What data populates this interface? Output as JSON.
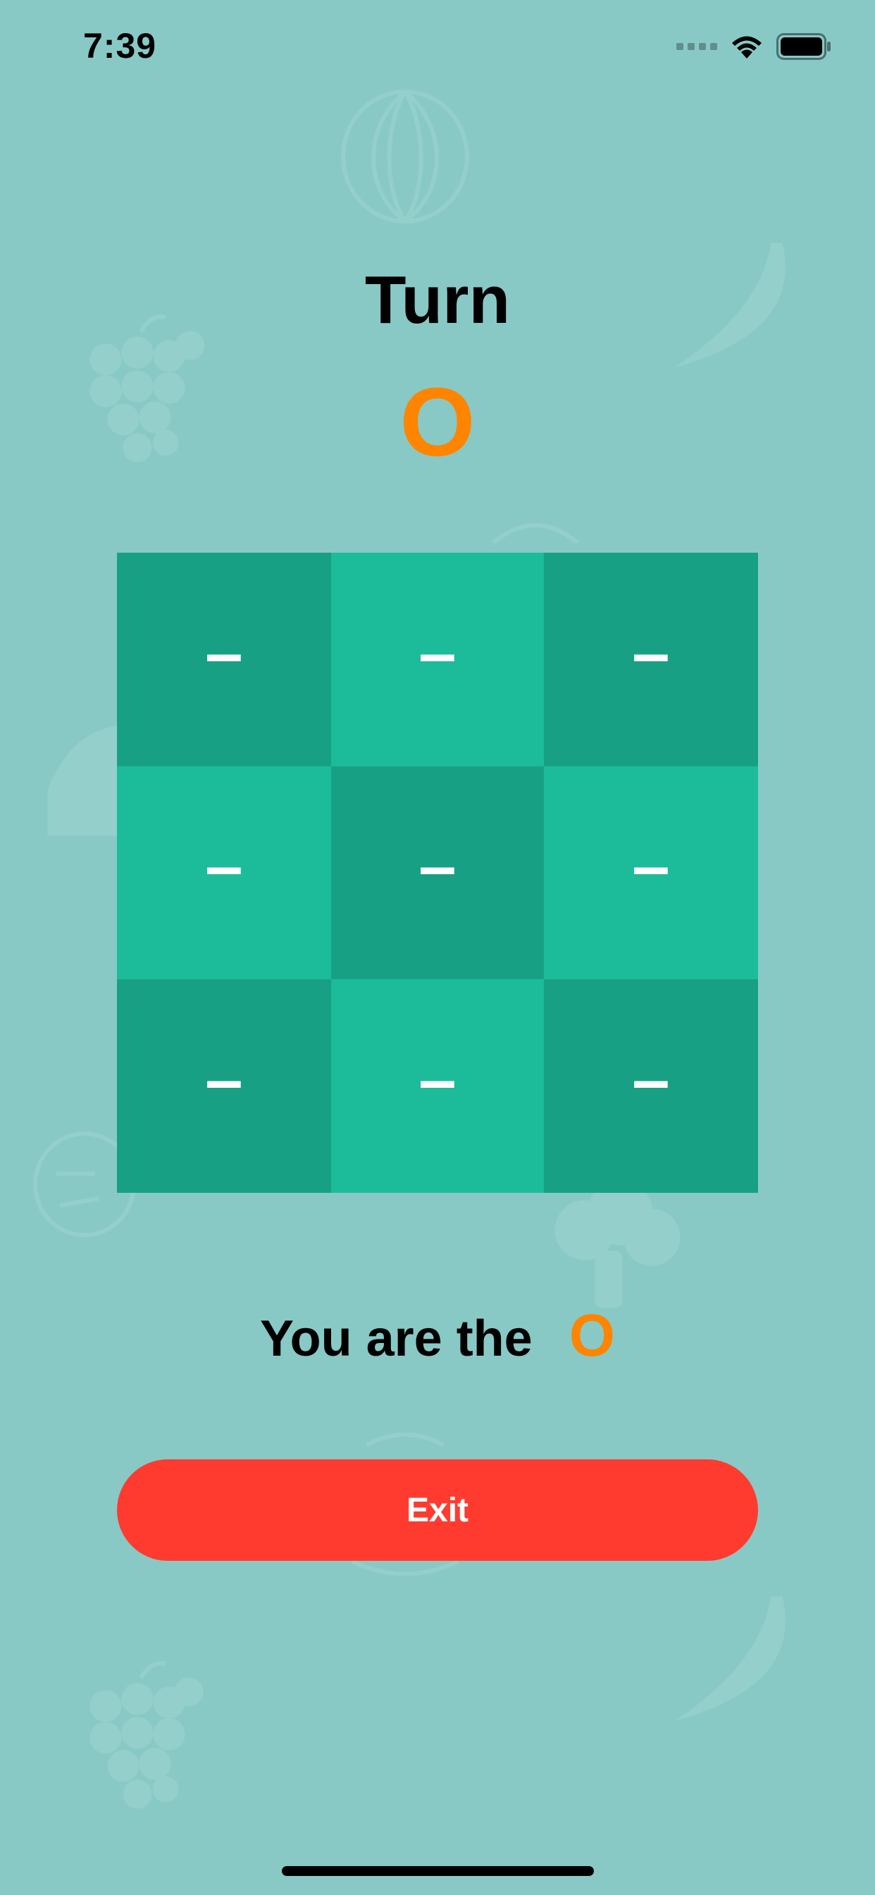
{
  "status_bar": {
    "time": "7:39"
  },
  "colors": {
    "background": "#88c9c6",
    "accent_orange": "#ff8500",
    "cell_dark": "#18a085",
    "cell_light": "#1cbc9a",
    "exit_red": "#ff3b30"
  },
  "turn": {
    "title": "Turn",
    "symbol": "O"
  },
  "board": {
    "cells": [
      "–",
      "–",
      "–",
      "–",
      "–",
      "–",
      "–",
      "–",
      "–"
    ]
  },
  "player": {
    "label": "You are the",
    "symbol": "O"
  },
  "exit_button": {
    "label": "Exit"
  },
  "icons": {
    "wifi": "wifi-icon",
    "battery": "battery-icon",
    "signal": "signal-icon"
  }
}
